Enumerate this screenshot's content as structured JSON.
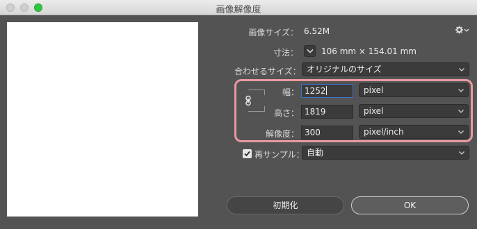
{
  "window": {
    "title": "画像解像度"
  },
  "image_size": {
    "label": "画像サイズ：",
    "value": "6.52M"
  },
  "dimensions": {
    "label": "寸法：",
    "value": "106 mm × 154.01 mm"
  },
  "fit_to": {
    "label": "合わせるサイズ：",
    "value": "オリジナルのサイズ"
  },
  "width": {
    "label": "幅：",
    "value": "1252",
    "unit": "pixel"
  },
  "height": {
    "label": "高さ：",
    "value": "1819",
    "unit": "pixel"
  },
  "resolution": {
    "label": "解像度：",
    "value": "300",
    "unit": "pixel/inch"
  },
  "resample": {
    "label": "再サンプル：",
    "checked": true,
    "value": "自動"
  },
  "buttons": {
    "reset": "初期化",
    "ok": "OK"
  },
  "colors": {
    "highlight": "#e89aa0",
    "focus": "#3a73c9"
  }
}
